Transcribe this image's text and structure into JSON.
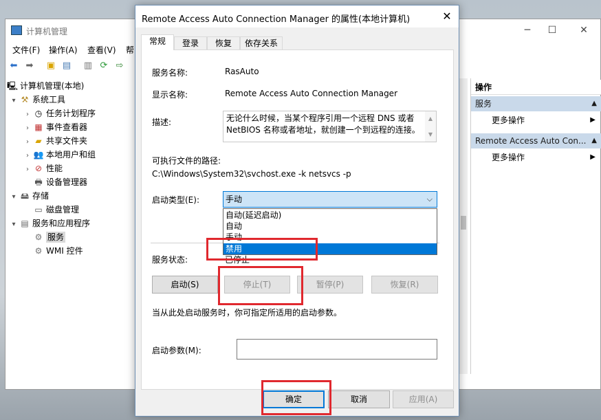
{
  "background_window": {
    "title": "计算机管理",
    "menu": [
      "文件(F)",
      "操作(A)",
      "查看(V)",
      "帮"
    ],
    "tree": [
      {
        "label": "计算机管理(本地)",
        "icon": "computer-icon",
        "expander": ""
      },
      {
        "label": "系统工具",
        "icon": "tools-icon",
        "expander": "▾"
      },
      {
        "label": "任务计划程序",
        "icon": "clock-icon",
        "expander": "›"
      },
      {
        "label": "事件查看器",
        "icon": "event-viewer-icon",
        "expander": "›"
      },
      {
        "label": "共享文件夹",
        "icon": "shared-folder-icon",
        "expander": "›"
      },
      {
        "label": "本地用户和组",
        "icon": "users-icon",
        "expander": "›"
      },
      {
        "label": "性能",
        "icon": "performance-icon",
        "expander": "›"
      },
      {
        "label": "设备管理器",
        "icon": "device-manager-icon",
        "expander": ""
      },
      {
        "label": "存储",
        "icon": "storage-icon",
        "expander": "▾"
      },
      {
        "label": "磁盘管理",
        "icon": "disk-icon",
        "expander": ""
      },
      {
        "label": "服务和应用程序",
        "icon": "services-apps-icon",
        "expander": "▾"
      },
      {
        "label": "服务",
        "icon": "gear-icon",
        "expander": ""
      },
      {
        "label": "WMI 控件",
        "icon": "wmi-icon",
        "expander": ""
      }
    ],
    "actions": {
      "header": "操作",
      "section1": "服务",
      "section1_item": "更多操作",
      "section2": "Remote Access Auto Con...",
      "section2_item": "更多操作"
    }
  },
  "dialog": {
    "title": "Remote Access Auto Connection Manager 的属性(本地计算机)",
    "tabs": [
      "常规",
      "登录",
      "恢复",
      "依存关系"
    ],
    "service_name_label": "服务名称:",
    "service_name": "RasAuto",
    "display_name_label": "显示名称:",
    "display_name": "Remote Access Auto Connection Manager",
    "description_label": "描述:",
    "description": "无论什么时候，当某个程序引用一个远程 DNS 或者 NetBIOS 名称或者地址，就创建一个到远程的连接。",
    "exe_path_label": "可执行文件的路径:",
    "exe_path": "C:\\Windows\\System32\\svchost.exe -k netsvcs -p",
    "startup_type_label": "启动类型(E):",
    "startup_type_value": "手动",
    "startup_options": [
      "自动(延迟启动)",
      "自动",
      "手动",
      "禁用"
    ],
    "highlighted_option": "禁用",
    "service_status_label": "服务状态:",
    "service_status_value": "已停止",
    "buttons": {
      "start": "启动(S)",
      "stop": "停止(T)",
      "pause": "暂停(P)",
      "resume": "恢复(R)"
    },
    "hint": "当从此处启动服务时，你可指定所适用的启动参数。",
    "start_params_label": "启动参数(M):",
    "start_params_value": "",
    "footer": {
      "ok": "确定",
      "cancel": "取消",
      "apply": "应用(A)"
    }
  },
  "colors": {
    "highlight_red": "#e0282e",
    "selection_blue": "#0078d7"
  }
}
